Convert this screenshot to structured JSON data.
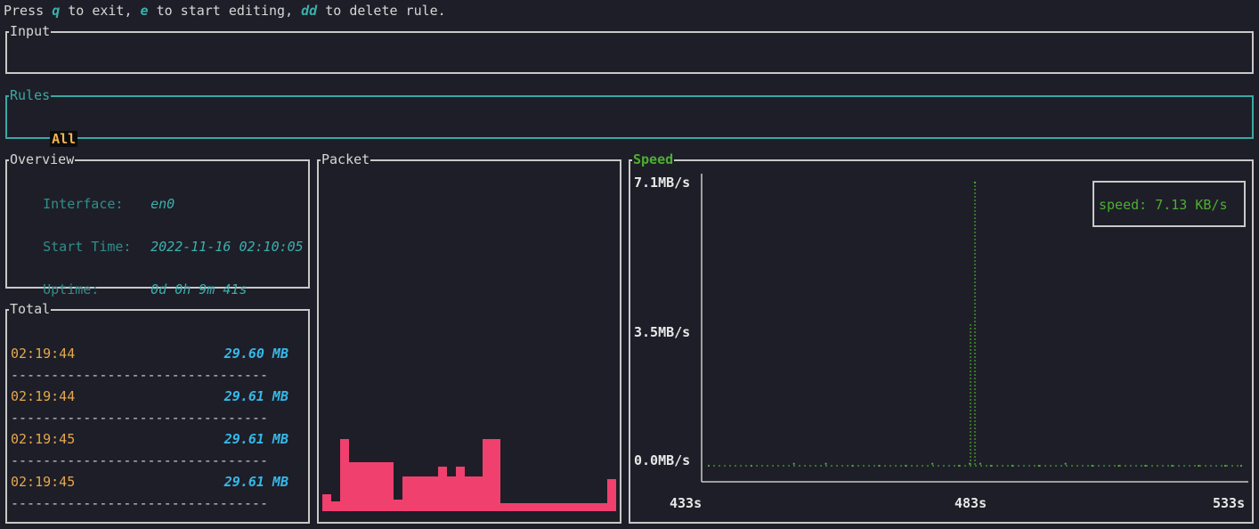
{
  "help": {
    "prefix": "Press ",
    "k1": "q",
    "t1": " to exit, ",
    "k2": "e",
    "t2": " to start editing, ",
    "k3": "dd",
    "t3": " to delete rule."
  },
  "input": {
    "title": "Input",
    "value": ""
  },
  "rules": {
    "title": "Rules",
    "items": [
      "All"
    ]
  },
  "overview": {
    "title": "Overview",
    "rows": [
      {
        "label": "Interface:",
        "value": "en0"
      },
      {
        "label": "Start Time:",
        "value": "2022-11-16 02:10:05"
      },
      {
        "label": "Uptime:",
        "value": "0d 0h 9m 41s"
      }
    ]
  },
  "total": {
    "title": "Total",
    "separator": "--------------------------------",
    "rows": [
      {
        "time": "02:19:44",
        "value": "29.60 MB"
      },
      {
        "time": "02:19:44",
        "value": "29.61 MB"
      },
      {
        "time": "02:19:45",
        "value": "29.61 MB"
      },
      {
        "time": "02:19:45",
        "value": "29.61 MB"
      }
    ]
  },
  "packet": {
    "title": "Packet",
    "bar_color": "#f0406e",
    "bars": [
      0.17,
      0.1,
      0.74,
      0.5,
      0.5,
      0.5,
      0.5,
      0.5,
      0.12,
      0.35,
      0.35,
      0.35,
      0.35,
      0.45,
      0.35,
      0.45,
      0.35,
      0.35,
      0.74,
      0.74,
      0.08,
      0.08,
      0.08,
      0.08,
      0.08,
      0.08,
      0.08,
      0.08,
      0.08,
      0.08,
      0.08,
      0.08,
      0.33
    ]
  },
  "speed": {
    "title": "Speed",
    "color": "#4caf30",
    "y_ticks": [
      "7.1MB/s",
      "3.5MB/s",
      "0.0MB/s"
    ],
    "x_ticks": [
      "433s",
      "483s",
      "533s"
    ],
    "legend": "speed: 7.13 KB/s",
    "chart_data": {
      "type": "line",
      "xlabel": "",
      "ylabel": "",
      "xlim": [
        433,
        533
      ],
      "ylim": [
        0,
        7.1
      ],
      "x_ticks": [
        "433s",
        "483s",
        "533s"
      ],
      "y_ticks": [
        "7.1MB/s",
        "3.5MB/s",
        "0.0MB/s"
      ],
      "series": [
        {
          "name": "speed: 7.13 KB/s",
          "x": [
            433,
            441,
            449,
            455,
            460,
            465,
            470,
            475,
            480,
            482,
            483,
            484,
            486,
            490,
            495,
            500,
            505,
            510,
            515,
            520,
            525,
            530,
            533
          ],
          "y": [
            0,
            0,
            0.05,
            0.05,
            0,
            0,
            0,
            0.05,
            0,
            0.05,
            7.1,
            0.05,
            0,
            0,
            0,
            0.05,
            0,
            0,
            0,
            0,
            0,
            0,
            0
          ]
        }
      ]
    }
  }
}
